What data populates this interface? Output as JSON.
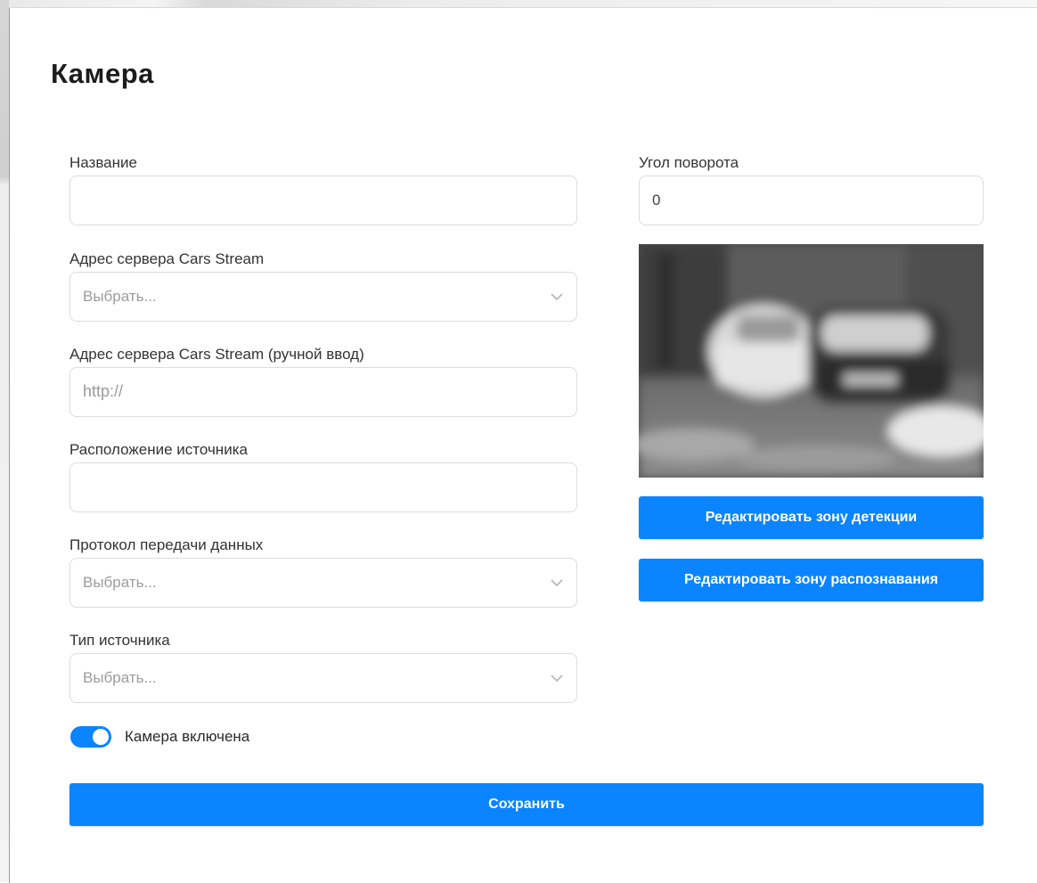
{
  "modal": {
    "title": "Камера"
  },
  "form": {
    "name": {
      "label": "Название",
      "value": ""
    },
    "rotation": {
      "label": "Угол поворота",
      "value": "0"
    },
    "server_select": {
      "label": "Адрес сервера Cars Stream",
      "value": "Выбрать..."
    },
    "server_manual": {
      "label": "Адрес сервера Cars Stream (ручной ввод)",
      "placeholder": "http://"
    },
    "location": {
      "label": "Расположение источника",
      "value": ""
    },
    "protocol": {
      "label": "Протокол передачи данных",
      "value": "Выбрать..."
    },
    "source_type": {
      "label": "Тип источника",
      "value": "Выбрать..."
    },
    "camera_enabled": {
      "label": "Камера включена",
      "checked": true
    }
  },
  "buttons": {
    "edit_detection": "Редактировать зону детекции",
    "edit_recognition": "Редактировать зону распознавания",
    "save": "Сохранить"
  },
  "colors": {
    "accent": "#0a84ff"
  },
  "icons": {
    "select_chevron": "chevron-down-icon"
  }
}
